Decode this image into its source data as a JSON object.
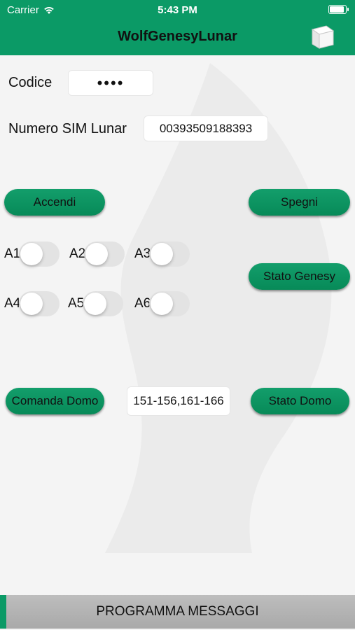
{
  "status_bar": {
    "carrier": "Carrier",
    "time": "5:43 PM"
  },
  "header": {
    "title": "WolfGenesyLunar",
    "icon": "cube-icon"
  },
  "form": {
    "codice_label": "Codice",
    "codice_value": "••••",
    "sim_label": "Numero SIM Lunar",
    "sim_value": "00393509188393"
  },
  "buttons": {
    "accendi": "Accendi",
    "spegni": "Spegni",
    "stato_genesy": "Stato Genesy",
    "comanda_domo": "Comanda Domo",
    "stato_domo": "Stato Domo"
  },
  "toggles": [
    {
      "label": "A1",
      "on": false
    },
    {
      "label": "A2",
      "on": false
    },
    {
      "label": "A3",
      "on": false
    },
    {
      "label": "A4",
      "on": false
    },
    {
      "label": "A5",
      "on": false
    },
    {
      "label": "A6",
      "on": false
    }
  ],
  "domo_field_value": "151-156,161-166",
  "bottom_bar": {
    "label": "PROGRAMMA MESSAGGI"
  },
  "colors": {
    "accent": "#0b9a66",
    "bottom_bar": "#b3b3b3"
  }
}
